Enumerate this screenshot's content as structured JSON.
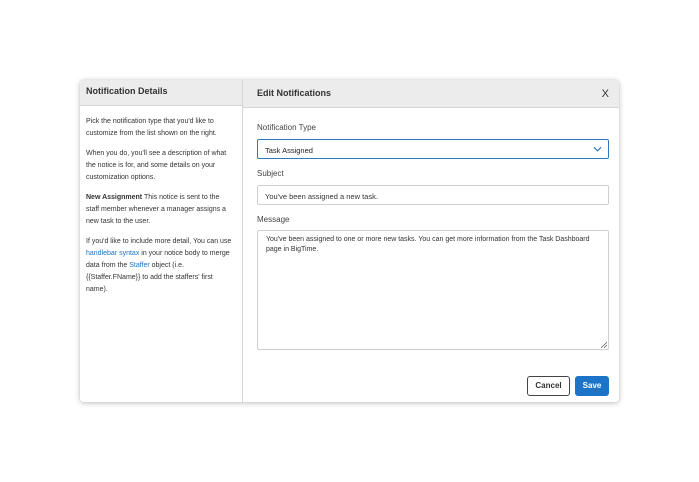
{
  "left_panel": {
    "title": "Notification Details",
    "para1": "Pick the notification type that you'd like to customize from the list shown on the right.",
    "para2": "When you do, you'll see a description of what the notice is for, and some details on your customization options.",
    "para3_bold": "New Assignment",
    "para3_rest": " This notice is sent to the staff member whenever a manager assigns a new task to the user.",
    "para4_a": "If you'd like to include more detail, You can use ",
    "para4_link1": "handlebar syntax",
    "para4_b": " in your notice body to merge data from the ",
    "para4_link2": "Staffer",
    "para4_c": " object (i.e. {{Staffer.FName}} to add the staffers' first name)."
  },
  "right_panel": {
    "title": "Edit Notifications",
    "close_label": "X",
    "notification_type_label": "Notification Type",
    "notification_type_value": "Task Assigned",
    "subject_label": "Subject",
    "subject_value": "You've been assigned a new task.",
    "message_label": "Message",
    "message_value": "You've been assigned to one or more new tasks. You can get more information from the Task Dashboard page in BigTime.",
    "cancel_label": "Cancel",
    "save_label": "Save"
  },
  "colors": {
    "accent": "#1c74c9",
    "link": "#1a73c8",
    "header_bg": "#ececec"
  },
  "icons": {
    "select_arrow": "chevron-down-icon",
    "close": "close-icon",
    "resize": "resize-handle-icon"
  }
}
